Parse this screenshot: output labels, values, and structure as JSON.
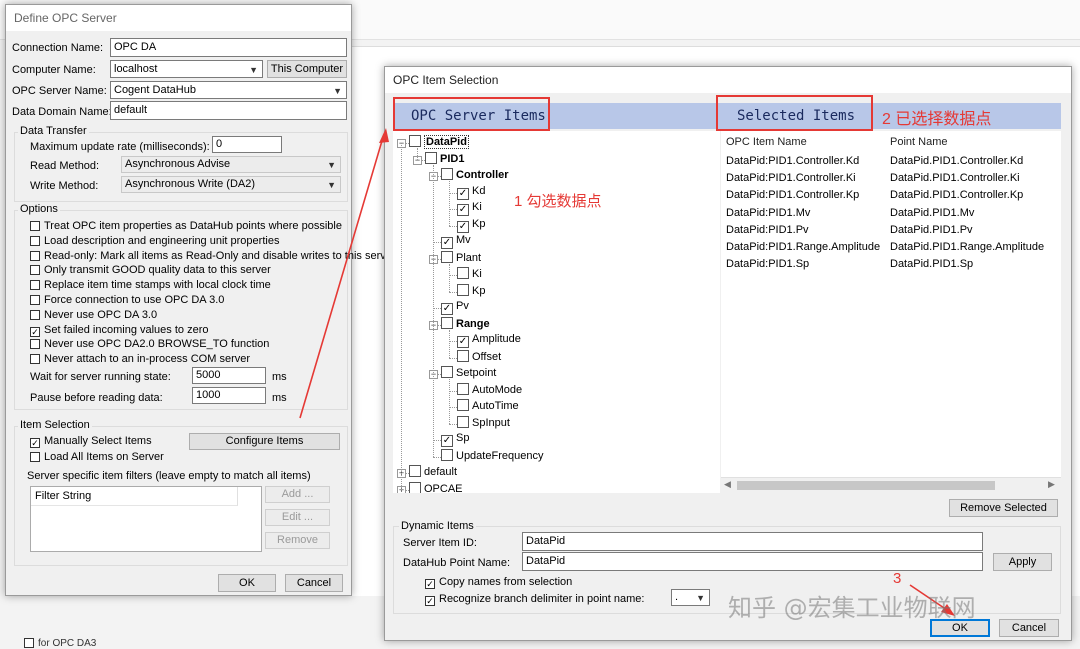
{
  "background": {
    "bottom_text": "for OPC DA3"
  },
  "define": {
    "title": "Define OPC Server",
    "connection_name_label": "Connection Name:",
    "connection_name": "OPC DA",
    "computer_name_label": "Computer Name:",
    "computer_name": "localhost",
    "this_computer": "This Computer",
    "server_name_label": "OPC Server Name:",
    "server_name": "Cogent DataHub",
    "domain_label": "Data Domain Name:",
    "domain": "default",
    "transfer": {
      "title": "Data Transfer",
      "rate_label": "Maximum update rate (milliseconds):",
      "rate": "0",
      "read_label": "Read Method:",
      "read": "Asynchronous Advise",
      "write_label": "Write Method:",
      "write": "Asynchronous Write (DA2)"
    },
    "options": {
      "title": "Options",
      "items": [
        {
          "label": "Treat OPC item properties as DataHub points where possible",
          "checked": false
        },
        {
          "label": "Load description and engineering unit properties",
          "checked": false
        },
        {
          "label": "Read-only: Mark all items as Read-Only and disable writes to this server",
          "checked": false
        },
        {
          "label": "Only transmit GOOD quality data to this server",
          "checked": false
        },
        {
          "label": "Replace item time stamps with local clock time",
          "checked": false
        },
        {
          "label": "Force connection to use OPC DA 3.0",
          "checked": false
        },
        {
          "label": "Never use OPC DA 3.0",
          "checked": false
        },
        {
          "label": "Set failed incoming values to zero",
          "checked": true
        },
        {
          "label": "Never use OPC DA2.0 BROWSE_TO function",
          "checked": false
        },
        {
          "label": "Never attach to an in-process COM server",
          "checked": false
        }
      ],
      "wait_label": "Wait for server running state:",
      "wait": "5000",
      "pause_label": "Pause before reading data:",
      "pause": "1000",
      "ms": "ms"
    },
    "item_selection": {
      "title": "Item Selection",
      "manual": "Manually Select Items",
      "load_all": "Load All Items on Server",
      "configure": "Configure Items",
      "filters_title": "Server specific item filters (leave empty to match all items)",
      "filter_header": "Filter String",
      "add": "Add ...",
      "edit": "Edit ...",
      "remove": "Remove"
    },
    "ok": "OK",
    "cancel": "Cancel"
  },
  "opc": {
    "title": "OPC Item Selection",
    "server_items": "OPC Server Items",
    "selected_items": "Selected Items",
    "ann1": "1 勾选数据点",
    "ann2": "2 已选择数据点",
    "ann3": "3",
    "tree": [
      {
        "label": "DataPid",
        "bold": true,
        "checked": false,
        "expander": "-",
        "level": 0
      },
      {
        "label": "PID1",
        "bold": true,
        "checked": false,
        "expander": "-",
        "level": 1
      },
      {
        "label": "Controller",
        "bold": true,
        "checked": false,
        "expander": "-",
        "level": 2
      },
      {
        "label": "Kd",
        "bold": false,
        "checked": true,
        "expander": "",
        "level": 3
      },
      {
        "label": "Ki",
        "bold": false,
        "checked": true,
        "expander": "",
        "level": 3
      },
      {
        "label": "Kp",
        "bold": false,
        "checked": true,
        "expander": "",
        "level": 3
      },
      {
        "label": "Mv",
        "bold": false,
        "checked": true,
        "expander": "",
        "level": 2
      },
      {
        "label": "Plant",
        "bold": false,
        "checked": false,
        "expander": "-",
        "level": 2
      },
      {
        "label": "Ki",
        "bold": false,
        "checked": false,
        "expander": "",
        "level": 3
      },
      {
        "label": "Kp",
        "bold": false,
        "checked": false,
        "expander": "",
        "level": 3
      },
      {
        "label": "Pv",
        "bold": false,
        "checked": true,
        "expander": "",
        "level": 2
      },
      {
        "label": "Range",
        "bold": true,
        "checked": false,
        "expander": "-",
        "level": 2
      },
      {
        "label": "Amplitude",
        "bold": false,
        "checked": true,
        "expander": "",
        "level": 3
      },
      {
        "label": "Offset",
        "bold": false,
        "checked": false,
        "expander": "",
        "level": 3
      },
      {
        "label": "Setpoint",
        "bold": false,
        "checked": false,
        "expander": "-",
        "level": 2
      },
      {
        "label": "AutoMode",
        "bold": false,
        "checked": false,
        "expander": "",
        "level": 3
      },
      {
        "label": "AutoTime",
        "bold": false,
        "checked": false,
        "expander": "",
        "level": 3
      },
      {
        "label": "SpInput",
        "bold": false,
        "checked": false,
        "expander": "",
        "level": 3
      },
      {
        "label": "Sp",
        "bold": false,
        "checked": true,
        "expander": "",
        "level": 2
      },
      {
        "label": "UpdateFrequency",
        "bold": false,
        "checked": false,
        "expander": "",
        "level": 2
      },
      {
        "label": "default",
        "bold": false,
        "checked": false,
        "expander": "+",
        "level": 0
      },
      {
        "label": "OPCAE",
        "bold": false,
        "checked": false,
        "expander": "+",
        "level": 0
      }
    ],
    "columns": [
      "OPC Item Name",
      "Point Name"
    ],
    "rows": [
      [
        "DataPid:PID1.Controller.Kd",
        "DataPid.PID1.Controller.Kd"
      ],
      [
        "DataPid:PID1.Controller.Ki",
        "DataPid.PID1.Controller.Ki"
      ],
      [
        "DataPid:PID1.Controller.Kp",
        "DataPid.PID1.Controller.Kp"
      ],
      [
        "DataPid:PID1.Mv",
        "DataPid.PID1.Mv"
      ],
      [
        "DataPid:PID1.Pv",
        "DataPid.PID1.Pv"
      ],
      [
        "DataPid:PID1.Range.Amplitude",
        "DataPid.PID1.Range.Amplitude"
      ],
      [
        "DataPid:PID1.Sp",
        "DataPid.PID1.Sp"
      ]
    ],
    "remove_selected": "Remove Selected",
    "dynamic": {
      "title": "Dynamic Items",
      "server_id_label": "Server Item ID:",
      "server_id": "DataPid",
      "point_name_label": "DataHub Point Name:",
      "point_name": "DataPid",
      "apply": "Apply",
      "copy_names": "Copy names from selection",
      "recognize": "Recognize branch delimiter in point name:",
      "delimiter": "."
    },
    "ok": "OK",
    "cancel": "Cancel"
  },
  "watermark": "知乎 @宏集工业物联网",
  "colors": {
    "accent": "#0078d7",
    "annotation": "#e53935",
    "header_band": "#b8c7e8"
  }
}
